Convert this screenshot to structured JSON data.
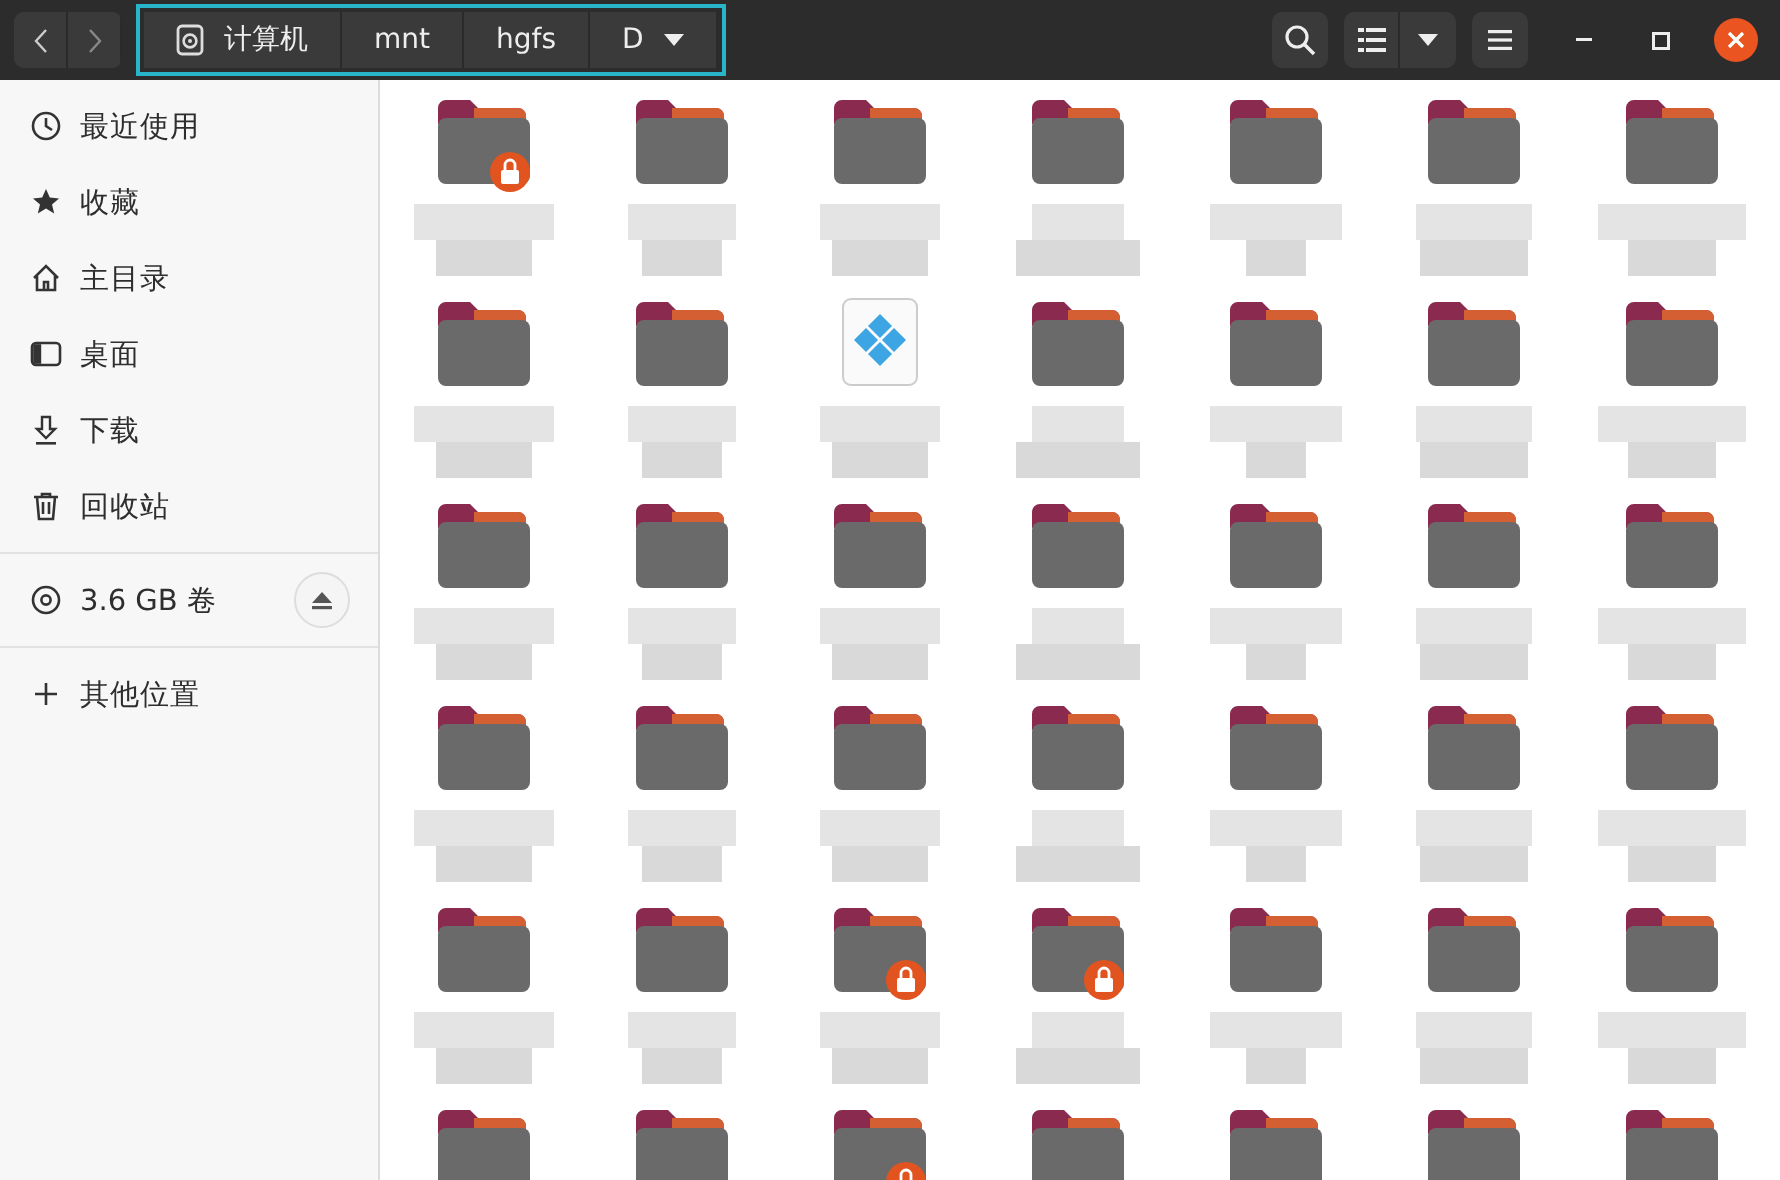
{
  "header": {
    "path": [
      {
        "label": "计算机",
        "kind": "computer"
      },
      {
        "label": "mnt",
        "kind": "dir"
      },
      {
        "label": "hgfs",
        "kind": "dir"
      },
      {
        "label": "D",
        "kind": "dir"
      }
    ]
  },
  "sidebar": {
    "places": [
      {
        "label": "最近使用",
        "kind": "recent"
      },
      {
        "label": "收藏",
        "kind": "starred"
      },
      {
        "label": "主目录",
        "kind": "home"
      },
      {
        "label": "桌面",
        "kind": "desktop"
      },
      {
        "label": "下载",
        "kind": "downloads"
      },
      {
        "label": "回收站",
        "kind": "trash"
      }
    ],
    "devices": [
      {
        "label": "3.6 GB 卷",
        "kind": "volume"
      }
    ],
    "other": [
      {
        "label": "其他位置",
        "kind": "other"
      }
    ]
  },
  "files": [
    {
      "kind": "folder",
      "locked": true
    },
    {
      "kind": "folder",
      "locked": false
    },
    {
      "kind": "folder",
      "locked": false
    },
    {
      "kind": "folder",
      "locked": false
    },
    {
      "kind": "folder",
      "locked": false
    },
    {
      "kind": "folder",
      "locked": false
    },
    {
      "kind": "folder",
      "locked": false
    },
    {
      "kind": "folder",
      "locked": false
    },
    {
      "kind": "folder",
      "locked": false
    },
    {
      "kind": "app",
      "locked": false
    },
    {
      "kind": "folder",
      "locked": false
    },
    {
      "kind": "folder",
      "locked": false
    },
    {
      "kind": "folder",
      "locked": false
    },
    {
      "kind": "folder",
      "locked": false
    },
    {
      "kind": "folder",
      "locked": false
    },
    {
      "kind": "folder",
      "locked": false
    },
    {
      "kind": "folder",
      "locked": false
    },
    {
      "kind": "folder",
      "locked": false
    },
    {
      "kind": "folder",
      "locked": false
    },
    {
      "kind": "folder",
      "locked": false
    },
    {
      "kind": "folder",
      "locked": false
    },
    {
      "kind": "folder",
      "locked": false
    },
    {
      "kind": "folder",
      "locked": false
    },
    {
      "kind": "folder",
      "locked": false
    },
    {
      "kind": "folder",
      "locked": false
    },
    {
      "kind": "folder",
      "locked": false
    },
    {
      "kind": "folder",
      "locked": false
    },
    {
      "kind": "folder",
      "locked": false
    },
    {
      "kind": "folder",
      "locked": false
    },
    {
      "kind": "folder",
      "locked": false
    },
    {
      "kind": "folder",
      "locked": true
    },
    {
      "kind": "folder",
      "locked": true
    },
    {
      "kind": "folder",
      "locked": false
    },
    {
      "kind": "folder",
      "locked": false
    },
    {
      "kind": "folder",
      "locked": false
    },
    {
      "kind": "folder",
      "locked": false
    },
    {
      "kind": "folder",
      "locked": false
    },
    {
      "kind": "folder",
      "locked": true
    },
    {
      "kind": "folder",
      "locked": false
    },
    {
      "kind": "folder",
      "locked": false
    },
    {
      "kind": "folder",
      "locked": false
    },
    {
      "kind": "folder",
      "locked": false
    }
  ]
}
